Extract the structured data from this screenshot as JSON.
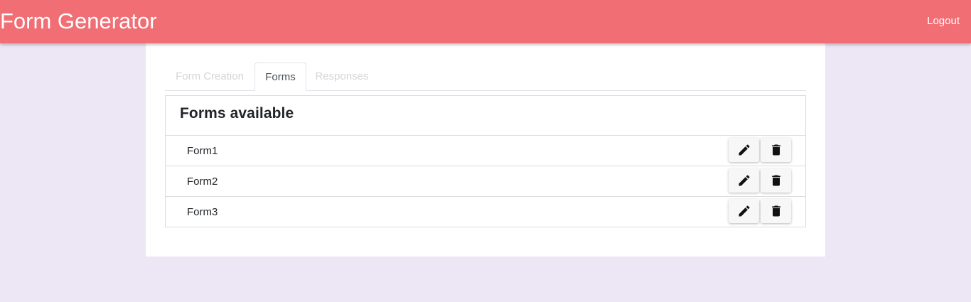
{
  "header": {
    "title": "Form Generator",
    "logout_label": "Logout"
  },
  "tabs": [
    {
      "label": "Form Creation",
      "active": false
    },
    {
      "label": "Forms",
      "active": true
    },
    {
      "label": "Responses",
      "active": false
    }
  ],
  "forms_panel": {
    "title": "Forms available",
    "rows": [
      {
        "name": "Form1"
      },
      {
        "name": "Form2"
      },
      {
        "name": "Form3"
      }
    ]
  },
  "icons": {
    "edit": "pencil-icon",
    "delete": "trash-icon"
  },
  "colors": {
    "navbar": "#f06e74",
    "background": "#ede6f5",
    "panel": "#ffffff"
  }
}
